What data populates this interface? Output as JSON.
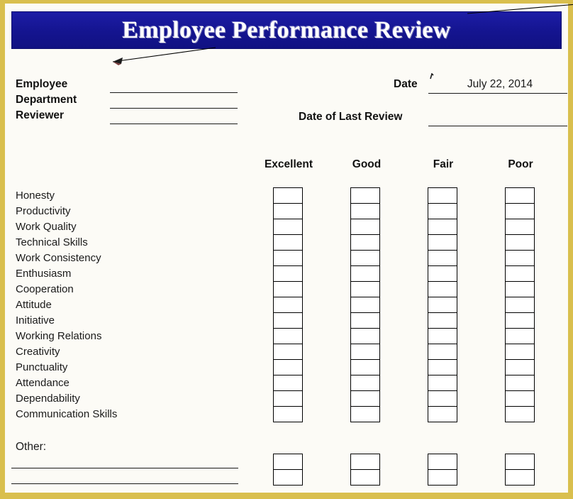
{
  "document": {
    "title": "Employee Performance Review",
    "theme": {
      "border_color": "#d9bf4e",
      "banner_color": "#14148f",
      "banner_text_color": "#ffffff",
      "page_background": "#fcfbf6",
      "ink_color": "#1a1a1a"
    }
  },
  "header_fields": {
    "left": [
      {
        "label": "Employee",
        "value": ""
      },
      {
        "label": "Department",
        "value": ""
      },
      {
        "label": "Reviewer",
        "value": ""
      }
    ],
    "right": [
      {
        "label": "Date",
        "value": "July 22, 2014"
      },
      {
        "label": "Date of Last Review",
        "value": ""
      }
    ]
  },
  "rating_scale": {
    "columns": [
      "Excellent",
      "Good",
      "Fair",
      "Poor"
    ]
  },
  "criteria": [
    "Honesty",
    "Productivity",
    "Work Quality",
    "Technical Skills",
    "Work Consistency",
    "Enthusiasm",
    "Cooperation",
    "Attitude",
    "Initiative",
    "Working Relations",
    "Creativity",
    "Punctuality",
    "Attendance",
    "Dependability",
    "Communication Skills"
  ],
  "other_section": {
    "label": "Other:",
    "blank_line_count": 2,
    "rating_row_count": 2
  },
  "annotations": [
    {
      "name": "callout-arrow-to-banner",
      "description": "thin black arrow pointing down-left beneath the title banner"
    },
    {
      "name": "callout-line-top-right",
      "description": "thin black line running off the top-right corner"
    }
  ]
}
